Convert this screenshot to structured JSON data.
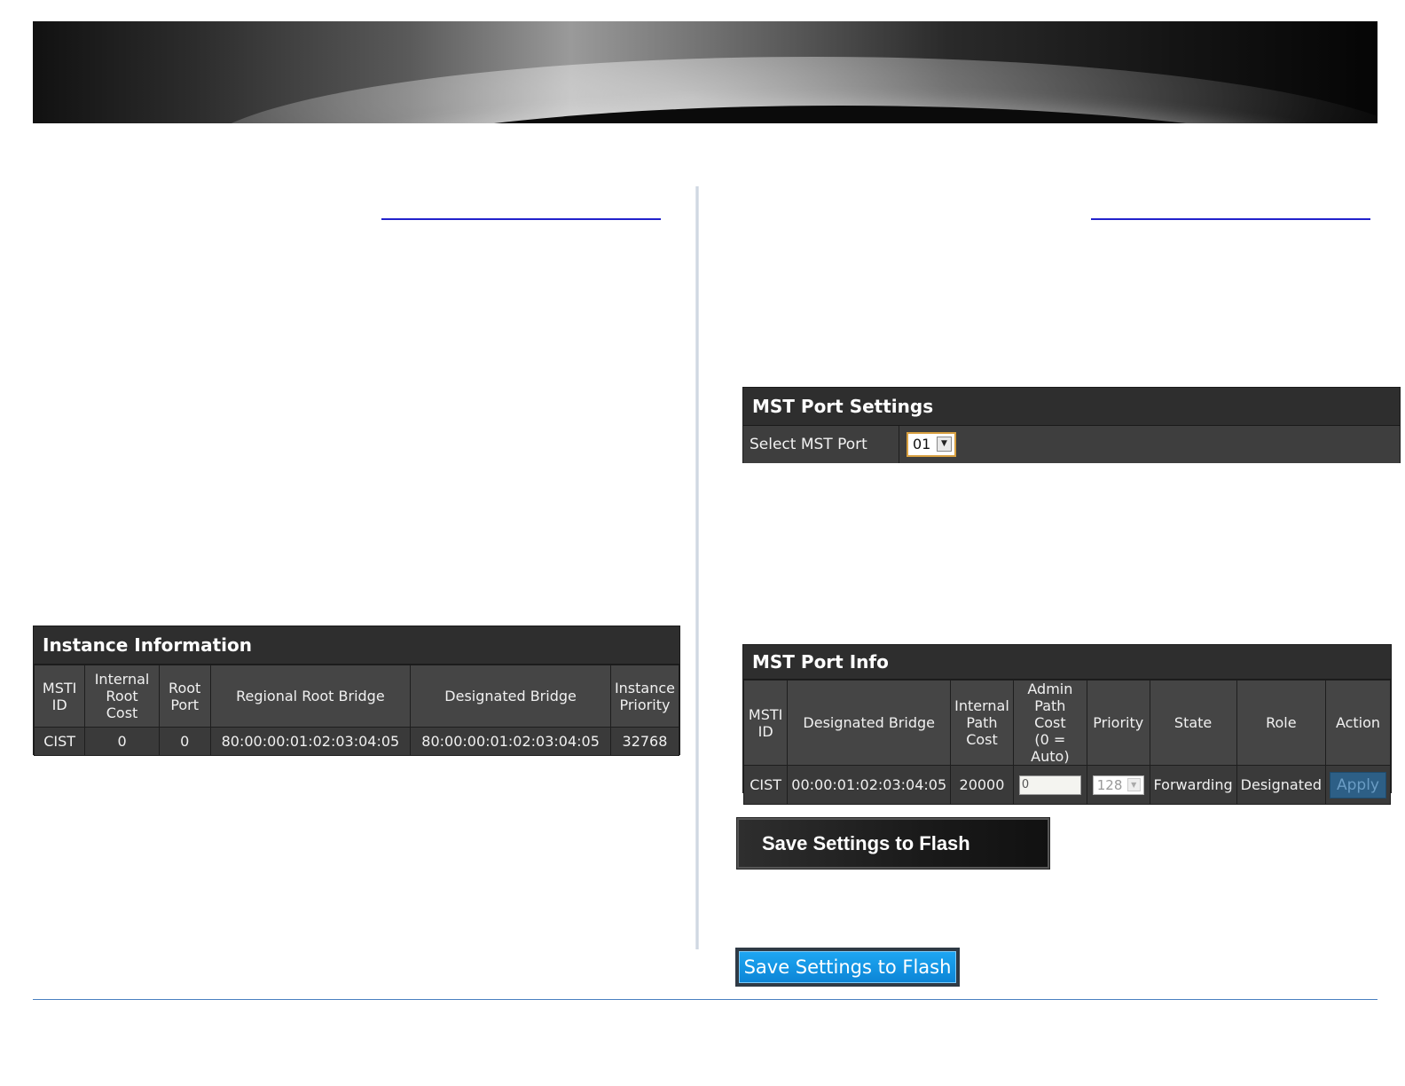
{
  "instance_info": {
    "title": "Instance Information",
    "headers": [
      "MSTI ID",
      "Internal Root Cost",
      "Root Port",
      "Regional Root Bridge",
      "Designated Bridge",
      "Instance Priority"
    ],
    "rows": [
      [
        "CIST",
        "0",
        "0",
        "80:00:00:01:02:03:04:05",
        "80:00:00:01:02:03:04:05",
        "32768"
      ]
    ]
  },
  "mst_port_settings": {
    "title": "MST Port Settings",
    "select_label": "Select MST Port",
    "selected_port": "01"
  },
  "mst_port_info": {
    "title": "MST Port Info",
    "headers": [
      "MSTI ID",
      "Designated Bridge",
      "Internal Path Cost",
      "Admin Path Cost (0 = Auto)",
      "Priority",
      "State",
      "Role",
      "Action"
    ],
    "row": {
      "msti_id": "CIST",
      "designated_bridge": "00:00:01:02:03:04:05",
      "internal_path_cost": "20000",
      "admin_path_cost": "0",
      "priority": "128",
      "state": "Forwarding",
      "role": "Designated",
      "action_label": "Apply"
    }
  },
  "buttons": {
    "save_dark": "Save Settings to Flash",
    "save_blue": "Save Settings to Flash"
  }
}
